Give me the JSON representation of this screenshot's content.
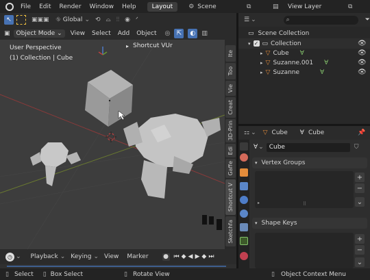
{
  "topbar": {
    "menus": [
      "File",
      "Edit",
      "Render",
      "Window",
      "Help"
    ],
    "active_tab": "Layout",
    "scene_label": "Scene",
    "view_layer_label": "View Layer"
  },
  "viewport_header": {
    "transform_orientation": "Global",
    "mode": "Object Mode",
    "menus": [
      "View",
      "Select",
      "Add",
      "Object"
    ]
  },
  "viewport": {
    "perspective_label": "User Perspective",
    "context_label": "(1) Collection | Cube",
    "shortcut_panel_title": "Shortcut VUr"
  },
  "sidebar_tabs": [
    "Ite",
    "Too",
    "Vie",
    "Creat",
    "3D-Prin",
    "Edi",
    "Gaffe",
    "Shortcut V",
    "Sketchfa"
  ],
  "timeline": {
    "menus": [
      "Playback",
      "Keying",
      "View",
      "Marker"
    ]
  },
  "statusbar": {
    "items": [
      "Select",
      "Box Select",
      "Rotate View",
      "Object Context Menu"
    ]
  },
  "outliner": {
    "root": "Scene Collection",
    "collection": "Collection",
    "objects": [
      {
        "name": "Cube",
        "icon": "mesh-icon"
      },
      {
        "name": "Suzanne.001",
        "icon": "mesh-icon"
      },
      {
        "name": "Suzanne",
        "icon": "mesh-icon"
      }
    ]
  },
  "properties": {
    "object_name": "Cube",
    "mesh_name": "Cube",
    "data_field": "Cube",
    "panels": [
      "Vertex Groups",
      "Shape Keys"
    ]
  },
  "colors": {
    "accent_blue": "#4772b3",
    "object_orange": "#e38c3b",
    "mesh_green": "#84c36c"
  }
}
